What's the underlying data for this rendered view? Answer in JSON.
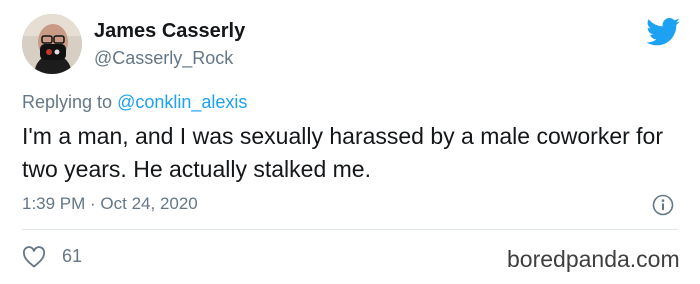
{
  "author": {
    "name": "James Casserly",
    "handle": "@Casserly_Rock"
  },
  "reply": {
    "prefix": "Replying to ",
    "mention": "@conklin_alexis"
  },
  "tweet": {
    "text": "I'm a man, and I was sexually harassed by a male coworker for two years. He actually stalked me.",
    "timestamp": "1:39 PM · Oct 24, 2020"
  },
  "stats": {
    "likes": "61"
  },
  "watermark": "boredpanda.com",
  "icons": {
    "logo": "twitter-bird-icon",
    "info": "info-icon",
    "like": "heart-icon"
  },
  "colors": {
    "brand": "#1da1f2",
    "text": "#14171a",
    "muted": "#657786",
    "divider": "#e1e8ed"
  }
}
